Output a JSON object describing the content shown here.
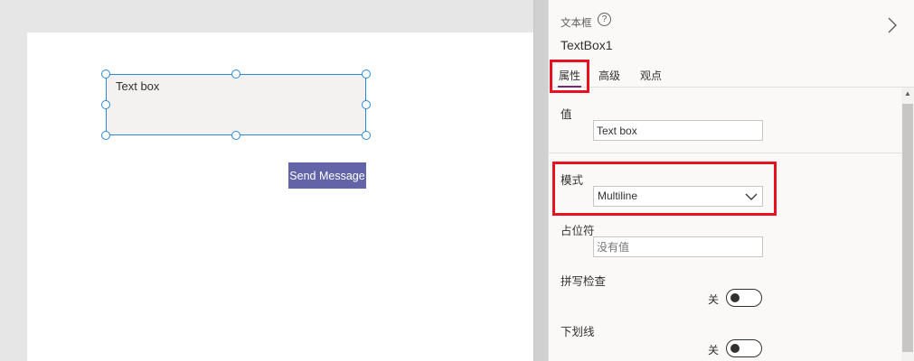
{
  "canvas": {
    "textbox_text": "Text box",
    "send_button_label": "Send Message"
  },
  "panel": {
    "control_type": "文本框",
    "control_name": "TextBox1",
    "tabs": [
      {
        "label": "属性",
        "active": true
      },
      {
        "label": "高级",
        "active": false
      },
      {
        "label": "观点",
        "active": false
      }
    ]
  },
  "properties": {
    "value": {
      "label": "值",
      "value": "Text box"
    },
    "mode": {
      "label": "模式",
      "selected": "Multiline"
    },
    "placeholder": {
      "label": "占位符",
      "placeholder": "没有值"
    },
    "spellcheck": {
      "label": "拼写检查",
      "state": "关"
    },
    "underline": {
      "label": "下划线",
      "state": "关"
    }
  },
  "colors": {
    "accent": "#742774",
    "button": "#6264a7",
    "selection": "#2b88d8",
    "highlight": "#e81123"
  }
}
